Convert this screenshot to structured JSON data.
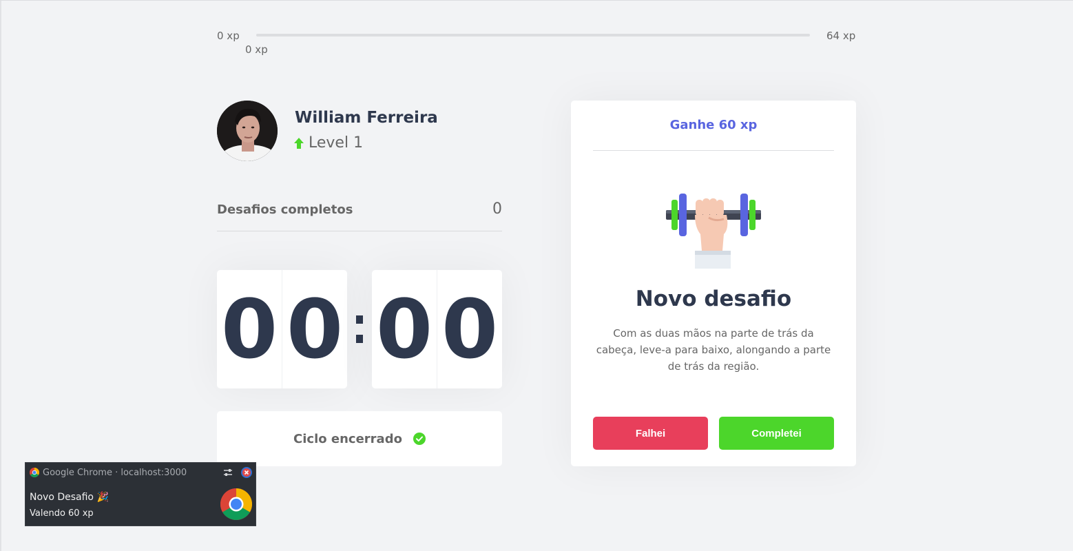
{
  "experience": {
    "min_label": "0 xp",
    "max_label": "64 xp",
    "current_label": "0 xp",
    "progress_fraction": 0
  },
  "profile": {
    "name": "William Ferreira",
    "level_label": "Level 1"
  },
  "completed": {
    "label": "Desafios completos",
    "count": "0"
  },
  "countdown": {
    "minute_left": "0",
    "minute_right": "0",
    "second_left": "0",
    "second_right": "0"
  },
  "cycle": {
    "label": "Ciclo encerrado"
  },
  "challenge": {
    "header": "Ganhe 60 xp",
    "title": "Novo desafio",
    "description": "Com as duas mãos na parte de trás da cabeça, leve-a para baixo, alongando a parte de trás da região.",
    "fail_label": "Falhei",
    "complete_label": "Completei",
    "art_icon": "dumbbell-arm-icon"
  },
  "notification": {
    "source": "Google Chrome · localhost:3000",
    "title": "Novo Desafio 🎉",
    "body": "Valendo 60 xp"
  },
  "colors": {
    "accent": "#5965e0",
    "green": "#4cd62b",
    "red": "#e83f5b",
    "text": "#666666",
    "title": "#2e384d",
    "background": "#f2f3f5"
  }
}
